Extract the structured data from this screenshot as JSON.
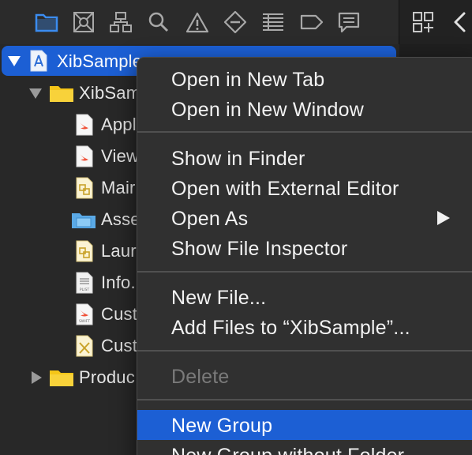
{
  "navigator_toolbar": {
    "icons": [
      {
        "name": "folder-icon",
        "active": true
      },
      {
        "name": "source-control-icon",
        "active": false
      },
      {
        "name": "hierarchy-icon",
        "active": false
      },
      {
        "name": "search-icon",
        "active": false
      },
      {
        "name": "warning-icon",
        "active": false
      },
      {
        "name": "test-diamond-icon",
        "active": false
      },
      {
        "name": "debug-list-icon",
        "active": false
      },
      {
        "name": "breakpoint-icon",
        "active": false
      },
      {
        "name": "report-icon",
        "active": false
      }
    ],
    "active_color": "#3b8cf0",
    "icon_color": "#a8a8a8"
  },
  "right_toolbar": {
    "icons": [
      "related-items-grid-icon",
      "chevron-left-icon"
    ]
  },
  "file_tree": {
    "items": [
      {
        "label": "XibSample",
        "icon": "xcode-project-icon",
        "disclosure": "expanded",
        "selected": true
      },
      {
        "label": "XibSam",
        "icon": "yellow-folder-icon",
        "disclosure": "expanded"
      },
      {
        "label": "Appl",
        "icon": "swift-file-icon"
      },
      {
        "label": "View",
        "icon": "swift-file-icon"
      },
      {
        "label": "Mair",
        "icon": "storyboard-file-icon"
      },
      {
        "label": "Asse",
        "icon": "asset-catalog-icon"
      },
      {
        "label": "Laur",
        "icon": "storyboard-file-icon"
      },
      {
        "label": "Info.",
        "icon": "plist-file-icon",
        "badge": "PLIST"
      },
      {
        "label": "Cust",
        "icon": "swift-file-icon",
        "badge": "SWIFT"
      },
      {
        "label": "Cust",
        "icon": "xib-file-icon"
      },
      {
        "label": "Produc",
        "icon": "yellow-folder-icon",
        "disclosure": "collapsed"
      }
    ]
  },
  "context_menu": {
    "items": [
      {
        "label": "Open in New Tab"
      },
      {
        "label": "Open in New Window"
      },
      {
        "label": "Show in Finder"
      },
      {
        "label": "Open with External Editor"
      },
      {
        "label": "Open As",
        "submenu": true
      },
      {
        "label": "Show File Inspector"
      },
      {
        "label": "New File..."
      },
      {
        "label": "Add Files to “XibSample”..."
      },
      {
        "label": "Delete",
        "disabled": true
      },
      {
        "label": "New Group",
        "highlighted": true
      },
      {
        "label": "New Group without Folder"
      }
    ]
  },
  "colors": {
    "selection_blue": "#1c5fd4",
    "menu_background": "#303030",
    "sidebar_background": "#282828",
    "folder_yellow": "#f5c518"
  }
}
